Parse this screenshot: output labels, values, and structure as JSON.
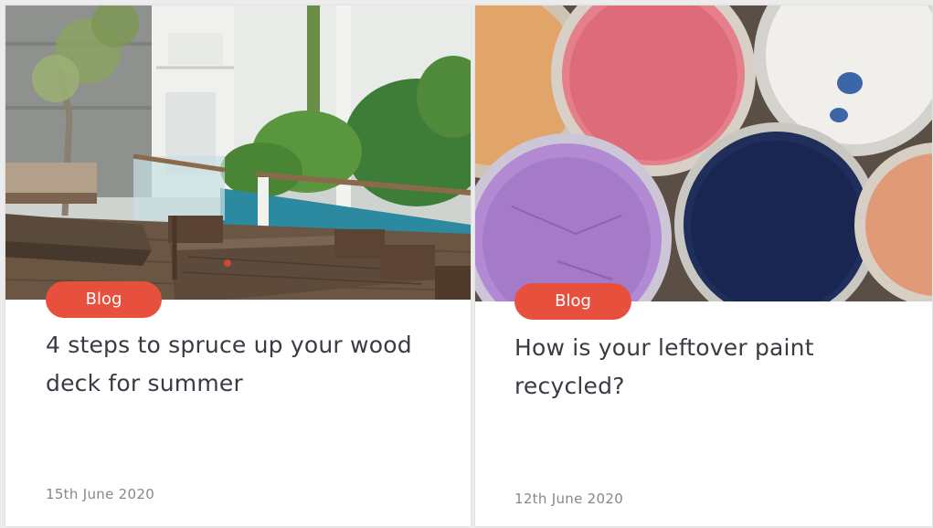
{
  "theme": {
    "accent": "#e8503e",
    "title_color": "#3a3a44",
    "date_color": "#888888"
  },
  "cards": [
    {
      "image_subject": "wooden deck with table and chairs beside a pool and tropical plants",
      "tag": "Blog",
      "title": "4 steps to spruce up your wood deck for summer",
      "date": "15th June 2020"
    },
    {
      "image_subject": "overhead view of open paint tins in orange, pink, white, purple, navy and peach",
      "tag": "Blog",
      "title": "How is your leftover paint recycled?",
      "date": "12th June 2020"
    }
  ]
}
